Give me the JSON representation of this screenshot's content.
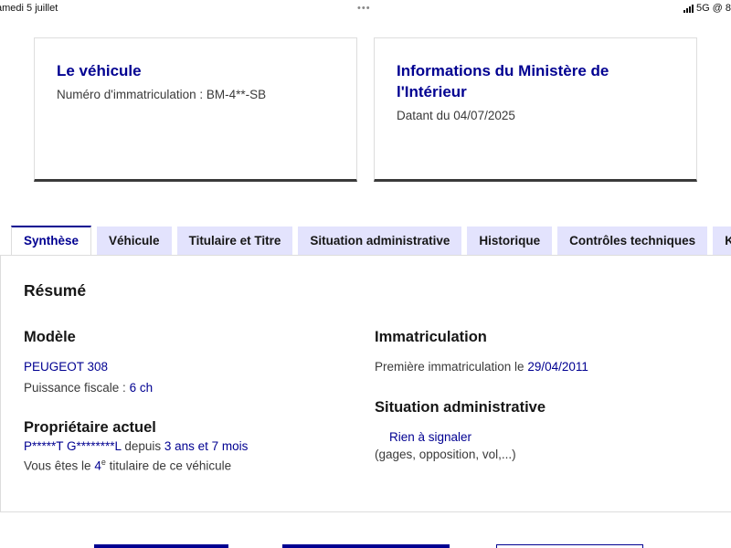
{
  "status_bar": {
    "date": "amedi 5 juillet",
    "dots": "•••",
    "network": "5G",
    "extra": "@ 8"
  },
  "cards": {
    "vehicule": {
      "title": "Le véhicule",
      "text": "Numéro d'immatriculation : BM-4**-SB"
    },
    "ministere": {
      "title_line1": "Informations du Ministère de",
      "title_line2": "l'Intérieur",
      "text": "Datant du 04/07/2025"
    }
  },
  "tabs": [
    {
      "label": "Synthèse",
      "active": true
    },
    {
      "label": "Véhicule",
      "active": false
    },
    {
      "label": "Titulaire et Titre",
      "active": false
    },
    {
      "label": "Situation administrative",
      "active": false
    },
    {
      "label": "Historique",
      "active": false
    },
    {
      "label": "Contrôles techniques",
      "active": false
    },
    {
      "label": "Kilo",
      "active": false
    }
  ],
  "panel": {
    "heading": "Résumé",
    "modele": {
      "heading": "Modèle",
      "name": "PEUGEOT 308",
      "puissance_label": "Puissance fiscale : ",
      "puissance_value": "6 ch"
    },
    "proprietaire": {
      "heading": "Propriétaire actuel",
      "name": "P*****T G********L",
      "depuis_label": " depuis ",
      "depuis_value": "3 ans et 7 mois",
      "titulaire_prefix": "Vous êtes le ",
      "titulaire_rank": "4",
      "titulaire_sup": "e",
      "titulaire_suffix": " titulaire de ce véhicule"
    },
    "immatriculation": {
      "heading": "Immatriculation",
      "label": "Première immatriculation le ",
      "date": "29/04/2011"
    },
    "situation": {
      "heading": "Situation administrative",
      "status": "Rien à signaler",
      "detail": "(gages, opposition, vol,...)"
    }
  },
  "colors": {
    "primary_blue": "#000091",
    "tab_background": "#e3e3fd",
    "border_dark": "#3a3a3a"
  }
}
